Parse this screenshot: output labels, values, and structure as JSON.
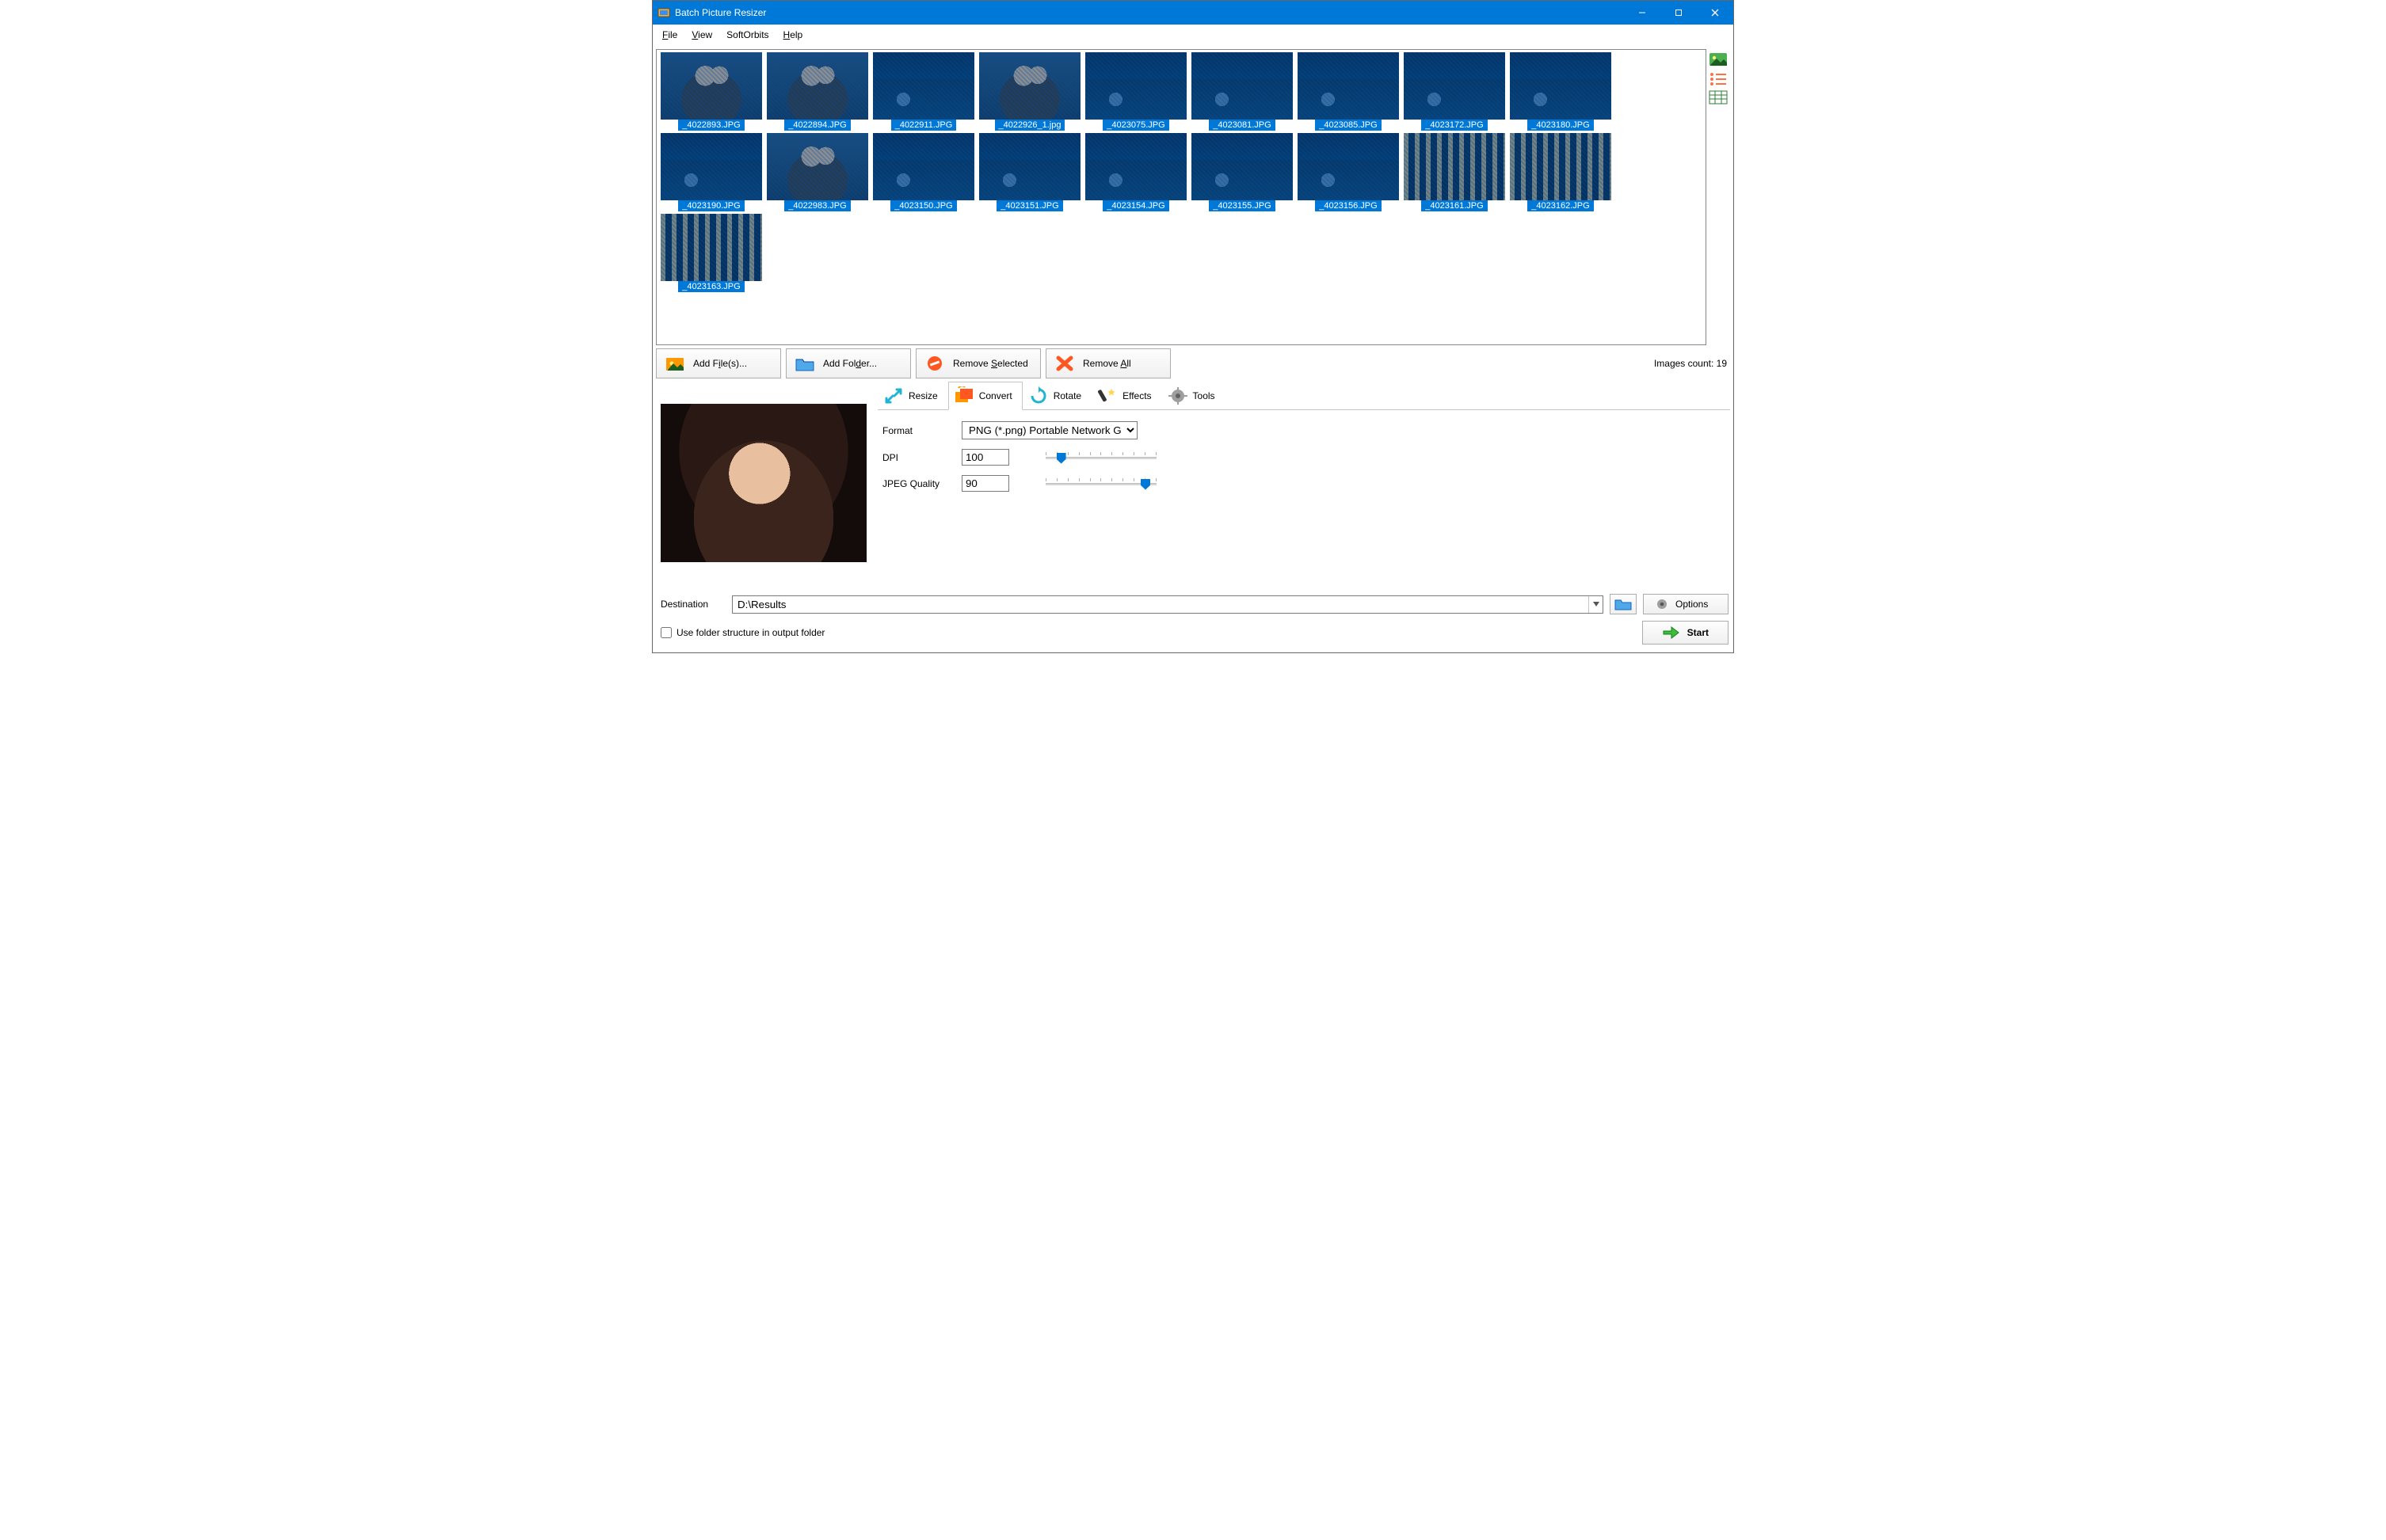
{
  "window": {
    "title": "Batch Picture Resizer"
  },
  "menu": {
    "file": "File",
    "view": "View",
    "softorbits": "SoftOrbits",
    "help": "Help"
  },
  "thumbs": [
    {
      "name": "_4022893.JPG",
      "style": "img-person"
    },
    {
      "name": "_4022894.JPG",
      "style": "img-person"
    },
    {
      "name": "_4022911.JPG",
      "style": "img-night"
    },
    {
      "name": "_4022926_1.jpg",
      "style": "img-person"
    },
    {
      "name": "_4023075.JPG",
      "style": "img-night"
    },
    {
      "name": "_4023081.JPG",
      "style": "img-night"
    },
    {
      "name": "_4023085.JPG",
      "style": "img-night"
    },
    {
      "name": "_4023172.JPG",
      "style": "img-night"
    },
    {
      "name": "_4023180.JPG",
      "style": "img-night"
    },
    {
      "name": "_4023190.JPG",
      "style": "img-night"
    },
    {
      "name": "_4022983.JPG",
      "style": "img-person"
    },
    {
      "name": "_4023150.JPG",
      "style": "img-night"
    },
    {
      "name": "_4023151.JPG",
      "style": "img-night"
    },
    {
      "name": "_4023154.JPG",
      "style": "img-night"
    },
    {
      "name": "_4023155.JPG",
      "style": "img-night"
    },
    {
      "name": "_4023156.JPG",
      "style": "img-night"
    },
    {
      "name": "_4023161.JPG",
      "style": "img-building"
    },
    {
      "name": "_4023162.JPG",
      "style": "img-building"
    },
    {
      "name": "_4023163.JPG",
      "style": "img-building"
    }
  ],
  "buttons": {
    "add_files": "Add File(s)...",
    "add_folder": "Add Folder...",
    "remove_selected": "Remove Selected",
    "remove_all": "Remove All"
  },
  "count_label": "Images count: 19",
  "tabs": {
    "resize": "Resize",
    "convert": "Convert",
    "rotate": "Rotate",
    "effects": "Effects",
    "tools": "Tools"
  },
  "convert": {
    "format_label": "Format",
    "format_value": "PNG (*.png) Portable Network Graph",
    "dpi_label": "DPI",
    "dpi_value": "100",
    "dpi_slider_pct": 14,
    "jpeg_label": "JPEG Quality",
    "jpeg_value": "90",
    "jpeg_slider_pct": 90
  },
  "dest": {
    "label": "Destination",
    "value": "D:\\Results",
    "options": "Options",
    "use_folder": "Use folder structure in output folder",
    "start": "Start"
  }
}
